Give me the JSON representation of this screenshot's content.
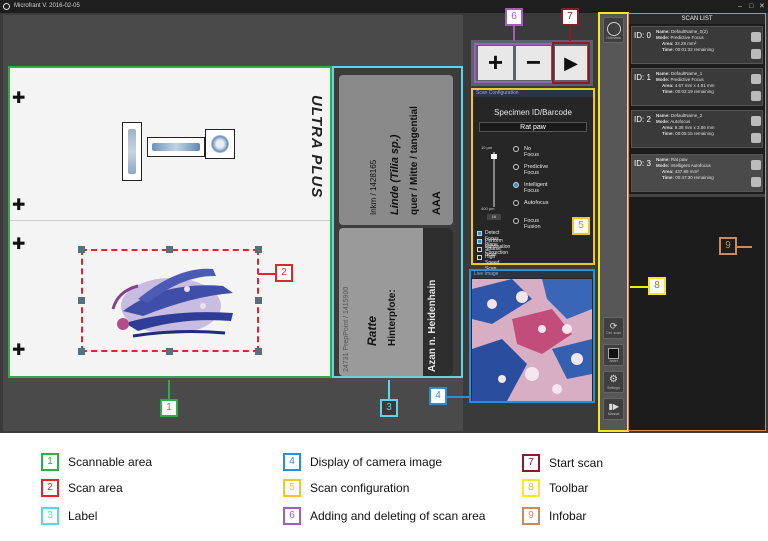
{
  "window": {
    "title": "Microfrant V. 2016-02-05",
    "controls": [
      "‒",
      "□",
      "✕"
    ]
  },
  "slide": {
    "brand": "ULTRA PLUS",
    "label_top_lines": [
      "Inkm / 1428165",
      "Linde (Tilia sp.)",
      "quer / Mitte / tangential",
      "AAA"
    ],
    "label_bottom_lines": [
      "24731 PrepPoint / 1415900",
      "Ratte",
      "Hinterpfote:",
      "Azan n. Heidenhain"
    ]
  },
  "scan_controls": {
    "add_label": "+",
    "remove_label": "−",
    "start_label": "▶"
  },
  "scan_config": {
    "header": "Scan Configuration",
    "title": "Specimen ID/Barcode",
    "specimen_id": "Rat paw",
    "slider_top": "10 µm",
    "slider_bottom": "400 µm",
    "slider_value": "16",
    "focus_options": [
      {
        "label": "No Focus",
        "selected": false
      },
      {
        "label": "Predictive Focus",
        "selected": false
      },
      {
        "label": "Intelligent Focus",
        "selected": true
      },
      {
        "label": "Autofocus",
        "selected": false
      },
      {
        "label": "Focus Fusion",
        "selected": false
      }
    ],
    "checkboxes": [
      {
        "label": "Detect Focus Plane",
        "checked": true
      },
      {
        "label": "Perform Illumination Correction",
        "checked": true
      },
      {
        "label": "Sparse Scan",
        "checked": false
      },
      {
        "label": "High Speed Scan",
        "checked": false
      }
    ]
  },
  "live_image": {
    "header": "Live Image"
  },
  "toolbar": {
    "top_button_label": "Overview",
    "buttons": [
      {
        "label": "Ctrl. scan",
        "icon": "refresh-icon"
      },
      {
        "label": "Abort",
        "icon": "stop-icon"
      },
      {
        "label": "Settings",
        "icon": "settings-icon"
      },
      {
        "label": "Manual",
        "icon": "manual-icon"
      }
    ]
  },
  "scan_list": {
    "title": "SCAN LIST",
    "items": [
      {
        "id": "ID: 0",
        "name": "DefaultName_0(2)",
        "mode": "Predictive Focus",
        "area": "32.28 mm²",
        "time": "00:01:32 remaining"
      },
      {
        "id": "ID: 1",
        "name": "DefaultName_1",
        "mode": "Predictive Focus",
        "area": "4.67 mm x 4.91 mm",
        "time": "00:02:19 remaining"
      },
      {
        "id": "ID: 2",
        "name": "DefaultName_2",
        "mode": "Autofocus",
        "area": "9.38 mm x 3.56 mm",
        "time": "00:05:15 remaining"
      },
      {
        "id": "ID: 3",
        "name": "Rat paw",
        "mode": "Intelligent Autofocus",
        "area": "437.89 mm²",
        "time": "00:47:30 remaining"
      }
    ],
    "field_labels": {
      "name": "Name:",
      "mode": "Mode:",
      "area": "Area:",
      "time": "Time:"
    }
  },
  "callouts": [
    "1",
    "2",
    "3",
    "4",
    "5",
    "6",
    "7",
    "8",
    "9"
  ],
  "colors": {
    "c1": "#2fad48",
    "c2": "#e0262b",
    "c3": "#5fd4e6",
    "c4": "#2a8fd6",
    "c5": "#f2c52a",
    "c6": "#a05fb4",
    "c7": "#8b1a2b",
    "c8": "#f4e62b",
    "c9": "#c98a5e"
  },
  "legend": [
    {
      "num": "1",
      "label": "Scannable area",
      "color": "#2fad48"
    },
    {
      "num": "2",
      "label": "Scan area",
      "color": "#e0262b"
    },
    {
      "num": "3",
      "label": "Label",
      "color": "#5fd4e6"
    },
    {
      "num": "4",
      "label": "Display of camera image",
      "color": "#2a8fd6"
    },
    {
      "num": "5",
      "label": "Scan configuration",
      "color": "#f2c52a"
    },
    {
      "num": "6",
      "label": "Adding and deleting of scan area",
      "color": "#a05fb4"
    },
    {
      "num": "7",
      "label": "Start scan",
      "color": "#8b1a2b"
    },
    {
      "num": "8",
      "label": "Toolbar",
      "color": "#f4e62b"
    },
    {
      "num": "9",
      "label": "Infobar",
      "color": "#c98a5e"
    }
  ]
}
